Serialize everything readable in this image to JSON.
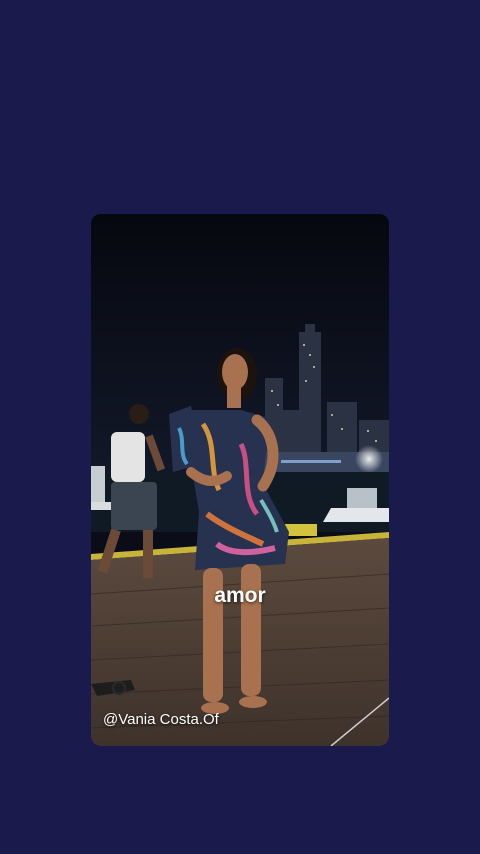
{
  "page": {
    "background": "#1a1a4d"
  },
  "video_card": {
    "caption": "amor",
    "handle": "@Vania Costa.Of"
  }
}
